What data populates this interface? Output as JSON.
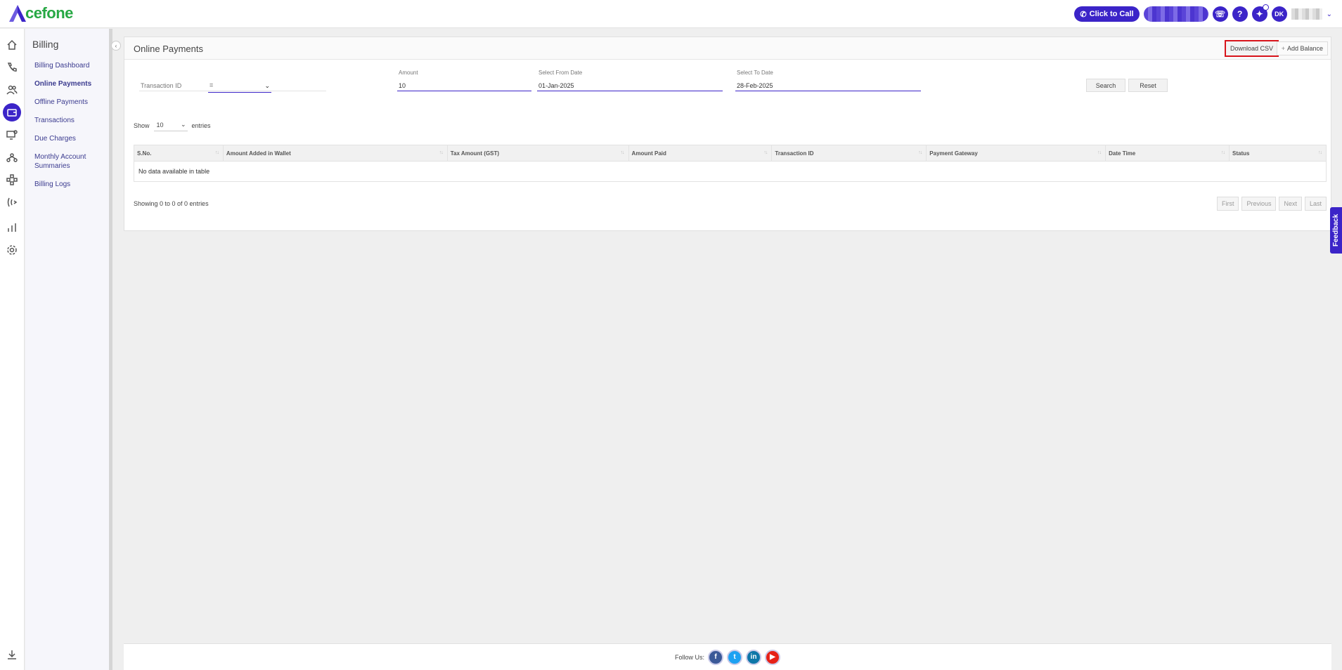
{
  "brand": {
    "logo_text": "cefone",
    "logo_color": "#27a844",
    "accent": "#3b24c8"
  },
  "header": {
    "click_to_call": "Click to Call",
    "avatar_initials": "DK"
  },
  "sidenav": {
    "title": "Billing",
    "items": [
      {
        "label": "Billing Dashboard"
      },
      {
        "label": "Online Payments"
      },
      {
        "label": "Offline Payments"
      },
      {
        "label": "Transactions"
      },
      {
        "label": "Due Charges"
      },
      {
        "label": "Monthly Account Summaries"
      },
      {
        "label": "Billing Logs"
      }
    ]
  },
  "page": {
    "title": "Online Payments",
    "download_csv": "Download CSV",
    "add_balance": "Add Balance"
  },
  "filters": {
    "transaction_id_placeholder": "Transaction ID",
    "amount_operator": "=",
    "amount_label": "Amount",
    "amount_value": "10",
    "from_label": "Select From Date",
    "from_value": "01-Jan-2025",
    "to_label": "Select To Date",
    "to_value": "28-Feb-2025",
    "search": "Search",
    "reset": "Reset"
  },
  "table": {
    "show_label": "Show",
    "entries_value": "10",
    "entries_label": "entries",
    "columns": [
      "S.No.",
      "Amount Added in Wallet",
      "Tax Amount (GST)",
      "Amount Paid",
      "Transaction ID",
      "Payment Gateway",
      "Date Time",
      "Status"
    ],
    "empty_text": "No data available in table",
    "info": "Showing 0 to 0 of 0 entries",
    "pager": {
      "first": "First",
      "previous": "Previous",
      "next": "Next",
      "last": "Last"
    }
  },
  "feedback": "Feedback",
  "footer": {
    "follow_us": "Follow Us:"
  }
}
